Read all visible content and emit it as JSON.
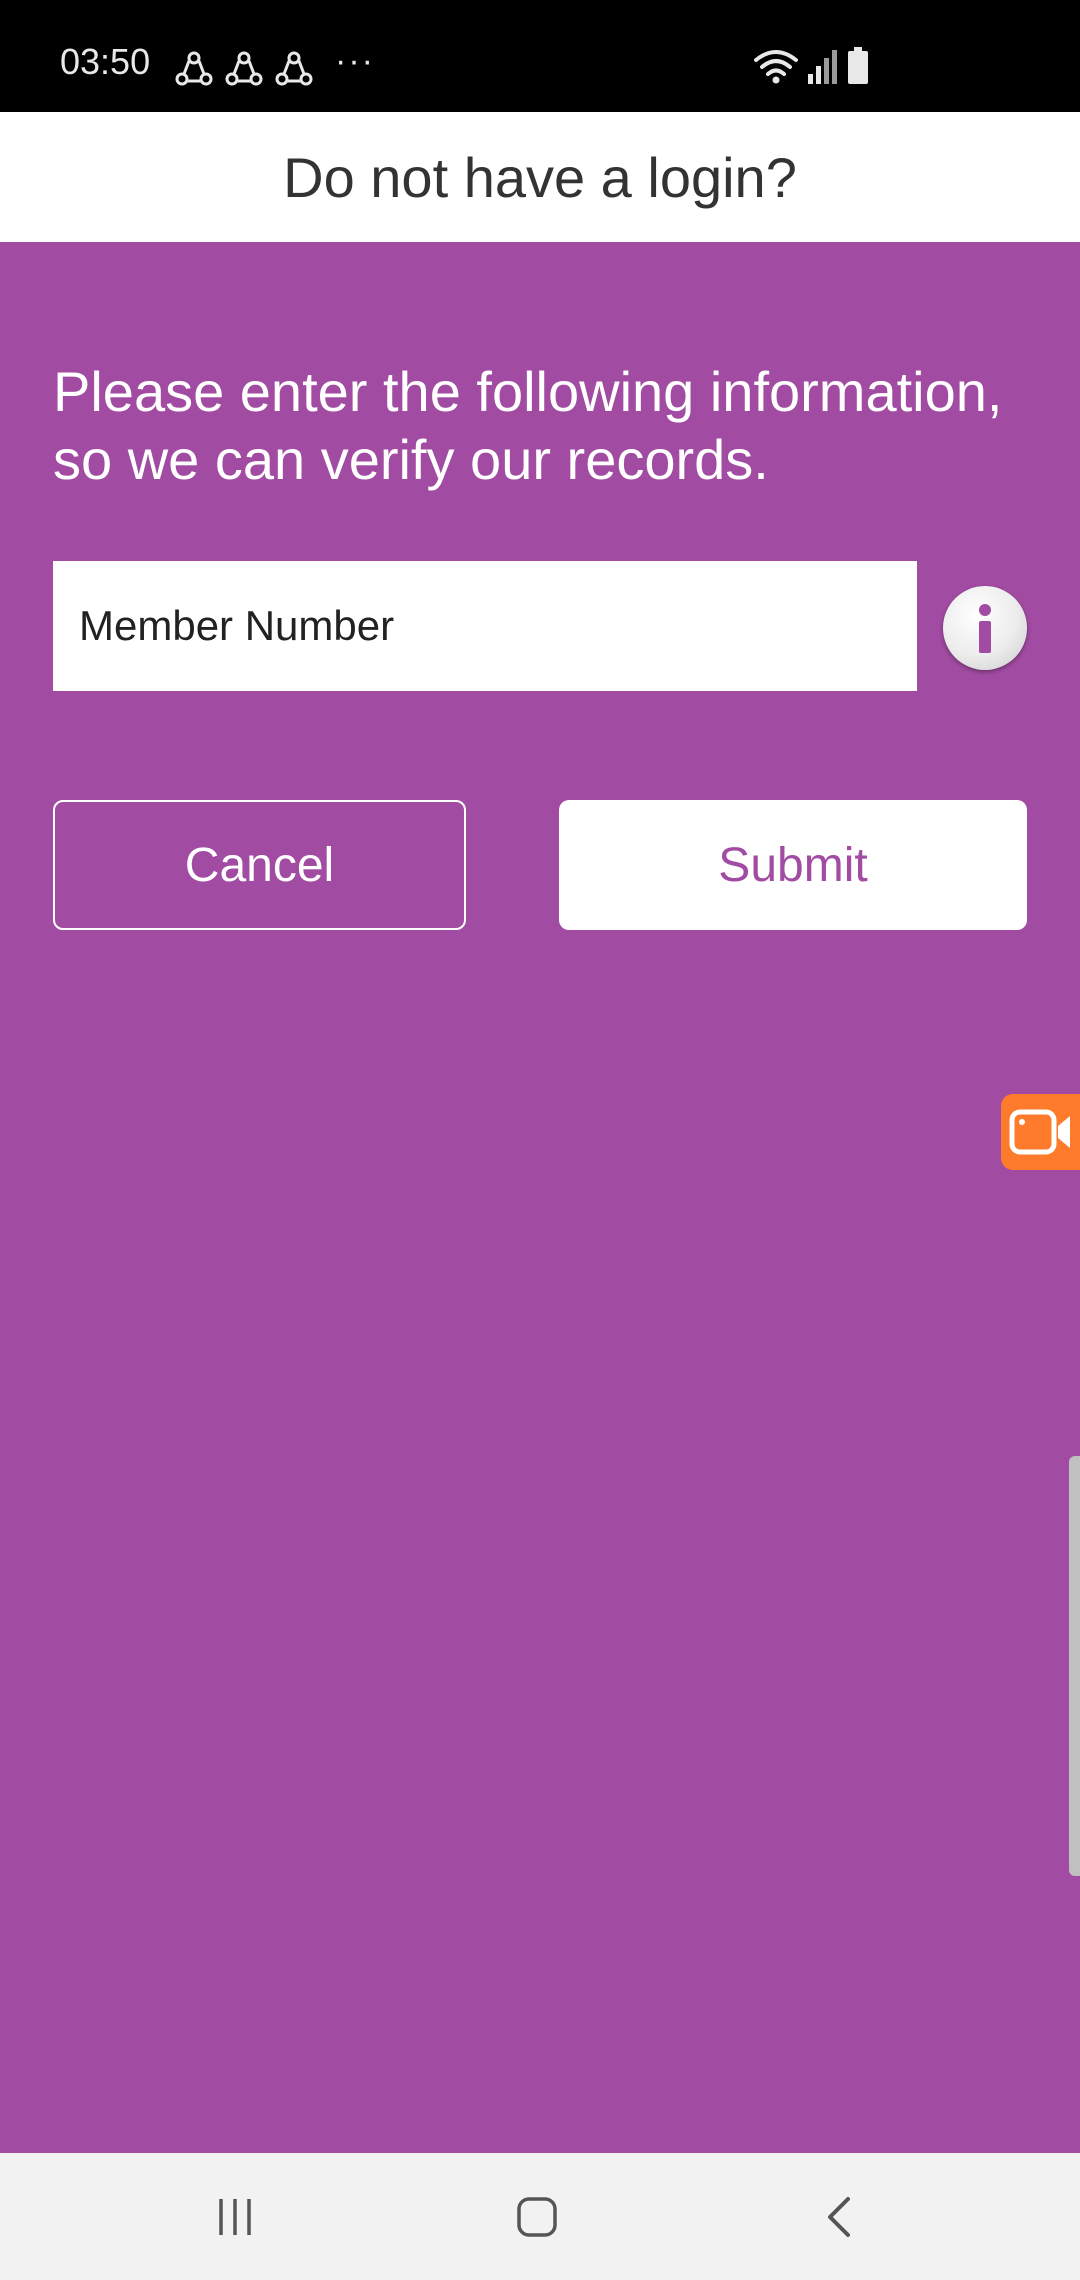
{
  "status_bar": {
    "time": "03:50",
    "more_indicator": "···",
    "notification_icons": [
      "share-icon",
      "share-icon",
      "share-icon"
    ],
    "right_icons": [
      "wifi-icon",
      "signal-icon",
      "battery-icon"
    ]
  },
  "header": {
    "title": "Do not have a login?"
  },
  "form": {
    "instructions": "Please enter the following information, so we can verify our records.",
    "member_number_placeholder": "Member Number",
    "member_number_value": "",
    "info_icon": "info-icon"
  },
  "actions": {
    "cancel_label": "Cancel",
    "submit_label": "Submit"
  },
  "overlay": {
    "recorder_icon": "screen-recorder-icon"
  },
  "nav": {
    "icons": [
      "recent-apps-icon",
      "home-icon",
      "back-icon"
    ]
  },
  "colors": {
    "background": "#a24ba2",
    "accent": "#a24ba2",
    "header_bg": "#ffffff",
    "recorder": "#ff7b2c"
  }
}
